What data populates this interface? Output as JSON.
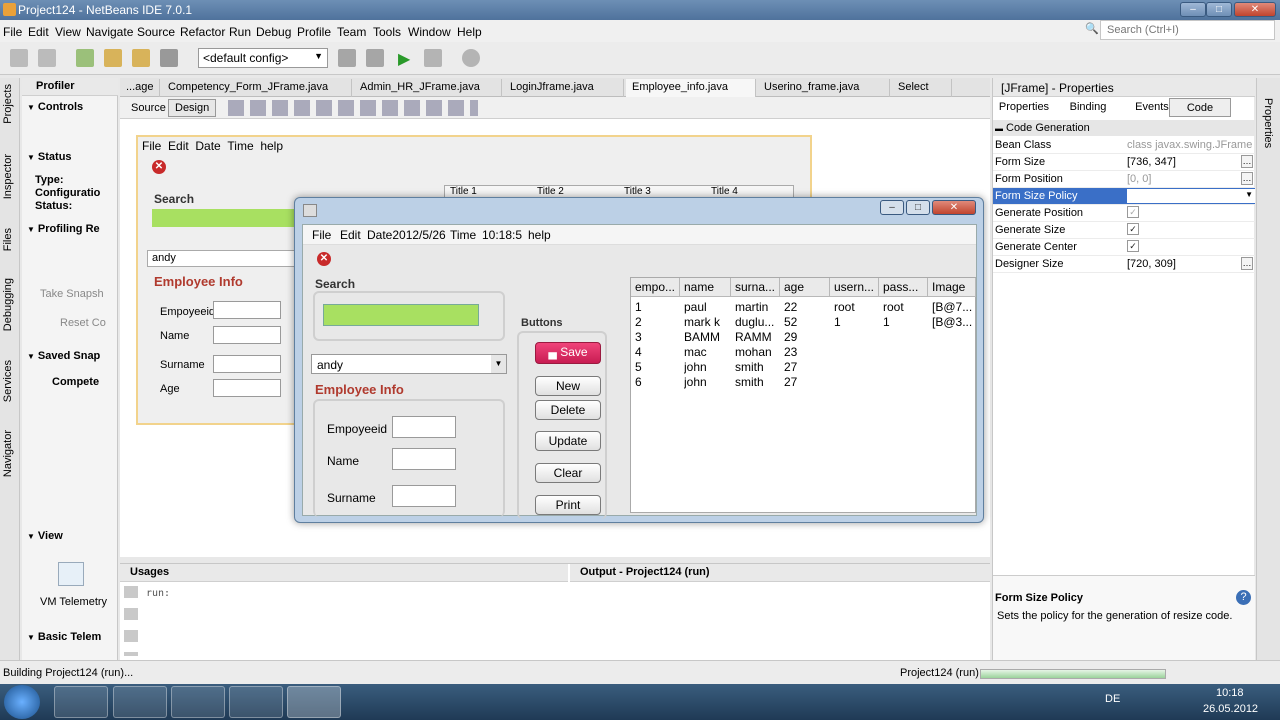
{
  "window": {
    "title": "Project124 - NetBeans IDE 7.0.1"
  },
  "menu": [
    "File",
    "Edit",
    "View",
    "Navigate",
    "Source",
    "Refactor",
    "Run",
    "Debug",
    "Profile",
    "Team",
    "Tools",
    "Window",
    "Help"
  ],
  "search": {
    "placeholder": "Search (Ctrl+I)"
  },
  "toolbar": {
    "config": "<default config>"
  },
  "left_tabs": [
    "Projects",
    "Inspector",
    "Files",
    "Debugging",
    "Services",
    "Navigator"
  ],
  "profiler": {
    "title": "Profiler",
    "controls": "Controls",
    "status": "Status",
    "type": "Type:",
    "configuration": "Configuratio",
    "status_label": "Status:",
    "profiling": "Profiling Re",
    "take_snapshot": "Take Snapsh",
    "reset": "Reset Co",
    "saved": "Saved Snap",
    "compete": "Compete",
    "view": "View",
    "vm_telemetry": "VM Telemetry",
    "basic": "Basic Telem"
  },
  "editor_tabs": [
    "...age",
    "Competency_Form_JFrame.java",
    "Admin_HR_JFrame.java",
    "LoginJframe.java",
    "Employee_info.java",
    "Userino_frame.java",
    "Select"
  ],
  "editor_toolbar": {
    "source": "Source",
    "design": "Design"
  },
  "bg_form": {
    "menu": [
      "File",
      "Edit",
      "Date",
      "Time",
      "help"
    ],
    "search": "Search",
    "combo": "andy",
    "emp_info": "Employee Info",
    "labels": [
      "Empoyeeid",
      "Name",
      "Surname",
      "Age"
    ],
    "titles": [
      "Title 1",
      "Title 2",
      "Title 3",
      "Title 4"
    ]
  },
  "app": {
    "menu": {
      "file": "File",
      "edit": "Edit",
      "date": "Date2012/5/26",
      "time": "Time",
      "clock": "10:18:5",
      "help": "help"
    },
    "search_label": "Search",
    "combo": "andy",
    "emp_info": "Employee Info",
    "labels": [
      "Empoyeeid",
      "Name",
      "Surname"
    ],
    "buttons_label": "Buttons",
    "buttons": [
      "Save",
      "New",
      "Delete",
      "Update",
      "Clear",
      "Print"
    ],
    "table": {
      "columns": [
        "empo...",
        "name",
        "surna...",
        "age",
        "usern...",
        "pass...",
        "Image"
      ],
      "rows": [
        [
          "1",
          "paul",
          "martin",
          "22",
          "root",
          "root",
          "[B@7..."
        ],
        [
          "2",
          "mark k",
          "duglu...",
          "52",
          "1",
          "1",
          "[B@3..."
        ],
        [
          "3",
          "BAMM",
          "RAMM",
          "29",
          "",
          "",
          ""
        ],
        [
          "4",
          "mac",
          "mohan",
          "23",
          "",
          "",
          ""
        ],
        [
          "5",
          "john",
          "smith",
          "27",
          "",
          "",
          ""
        ],
        [
          "6",
          "john",
          "smith",
          "27",
          "",
          "",
          ""
        ]
      ]
    }
  },
  "properties": {
    "title": "[JFrame] - Properties",
    "tabs": [
      "Properties",
      "Binding",
      "Events",
      "Code"
    ],
    "section": "Code Generation",
    "rows": [
      [
        "Bean Class",
        "class javax.swing.JFrame"
      ],
      [
        "Form Size",
        "[736, 347]"
      ],
      [
        "Form Position",
        "[0, 0]"
      ],
      [
        "Form Size Policy",
        ""
      ],
      [
        "Generate Position",
        ""
      ],
      [
        "Generate Size",
        ""
      ],
      [
        "Generate Center",
        ""
      ],
      [
        "Designer Size",
        "[720, 309]"
      ]
    ],
    "help_title": "Form Size Policy",
    "help_text": "Sets the policy for the generation of resize code."
  },
  "right_tab": "Properties",
  "bottom": {
    "usages": "Usages",
    "output": "Output - Project124 (run)",
    "run": "run:"
  },
  "status": {
    "left": "Building Project124 (run)...",
    "right": "Project124 (run)"
  },
  "taskbar": {
    "lang": "DE",
    "time": "10:18",
    "date": "26.05.2012"
  }
}
